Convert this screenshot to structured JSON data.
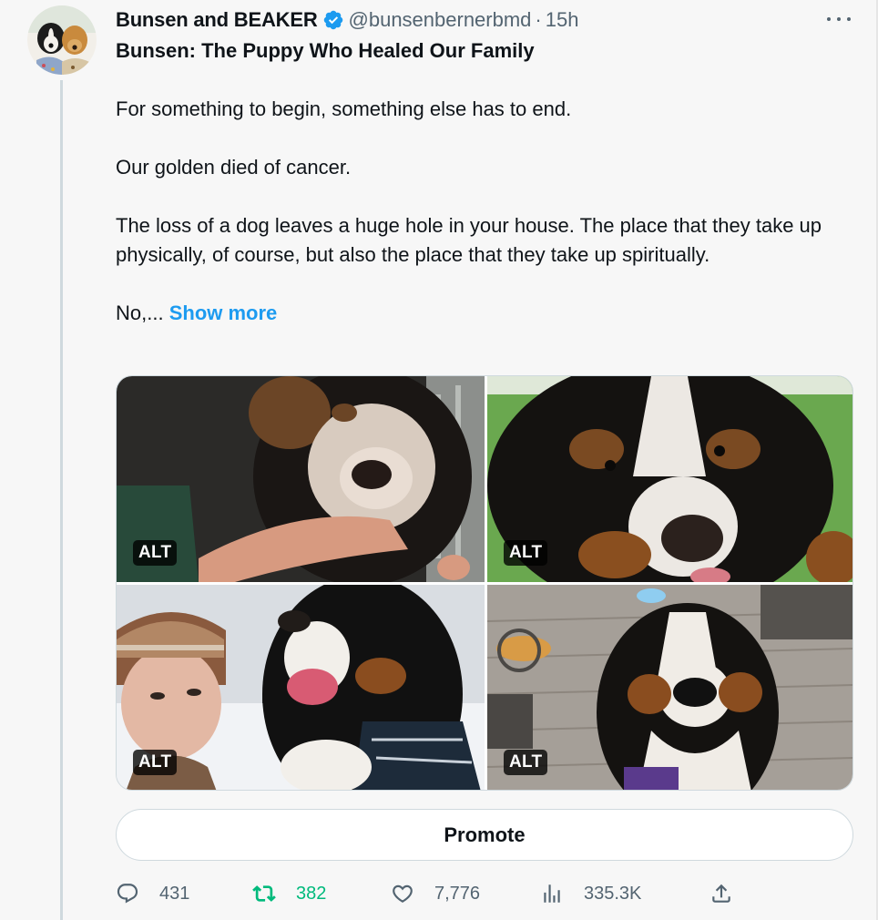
{
  "author": {
    "display_name": "Bunsen and BEAKER",
    "handle": "@bunsenbernerbmd",
    "separator": "·",
    "time": "15h",
    "verified_color": "#1d9bf0"
  },
  "post": {
    "title": "Bunsen: The Puppy Who Healed Our Family",
    "paragraphs": [
      "For something to begin, something else has to end.",
      "Our golden died of cancer.",
      "The loss of a dog leaves a huge hole in your house.  The place that they take up physically, of course, but also the place that they take up spiritually."
    ],
    "truncated_text": "No,...",
    "show_more_label": "Show more"
  },
  "media": [
    {
      "alt_label": "ALT"
    },
    {
      "alt_label": "ALT"
    },
    {
      "alt_label": "ALT"
    },
    {
      "alt_label": "ALT"
    }
  ],
  "promote_label": "Promote",
  "actions": {
    "replies": "431",
    "reposts": "382",
    "likes": "7,776",
    "views": "335.3K"
  },
  "colors": {
    "accent": "#1d9bf0",
    "repost_active": "#00ba7c",
    "muted": "#536471"
  }
}
